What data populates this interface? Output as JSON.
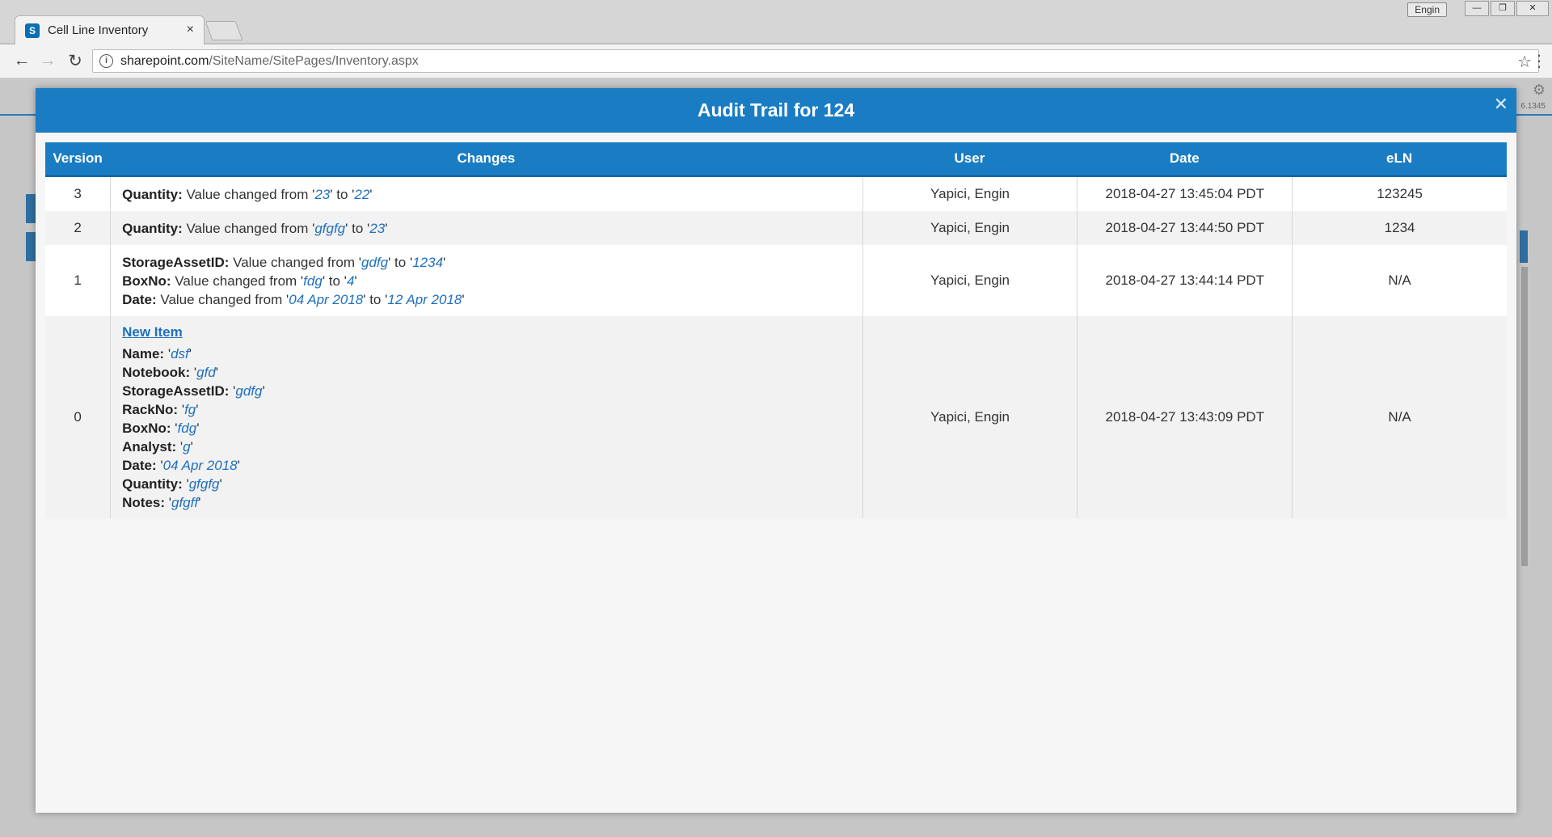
{
  "browser": {
    "user_chip": "Engin",
    "win_minimize": "—",
    "win_maximize": "❐",
    "win_close": "✕",
    "tab_favicon_letter": "S",
    "tab_title": "Cell Line Inventory",
    "tab_close": "×",
    "url_host": "sharepoint.com",
    "url_path": "/SiteName/SitePages/Inventory.aspx",
    "page_number": "6.1345"
  },
  "modal": {
    "title": "Audit Trail for 124",
    "close_glyph": "✕",
    "headers": {
      "version": "Version",
      "changes": "Changes",
      "user": "User",
      "date": "Date",
      "eln": "eLN"
    },
    "rows": [
      {
        "version": "3",
        "user": "Yapici, Engin",
        "date": "2018-04-27 13:45:04 PDT",
        "eln": "123245",
        "changes": [
          {
            "field": "Quantity:",
            "text": " Value changed from '",
            "from": "23",
            "mid": "' to '",
            "to": "22",
            "end": "'"
          }
        ]
      },
      {
        "version": "2",
        "user": "Yapici, Engin",
        "date": "2018-04-27 13:44:50 PDT",
        "eln": "1234",
        "changes": [
          {
            "field": "Quantity:",
            "text": " Value changed from '",
            "from": "gfgfg",
            "mid": "' to '",
            "to": "23",
            "end": "'"
          }
        ]
      },
      {
        "version": "1",
        "user": "Yapici, Engin",
        "date": "2018-04-27 13:44:14 PDT",
        "eln": "N/A",
        "changes": [
          {
            "field": "StorageAssetID:",
            "text": " Value changed from '",
            "from": "gdfg",
            "mid": "' to '",
            "to": "1234",
            "end": "'"
          },
          {
            "field": "BoxNo:",
            "text": " Value changed from '",
            "from": "fdg",
            "mid": "' to '",
            "to": "4",
            "end": "'"
          },
          {
            "field": "Date:",
            "text": " Value changed from '",
            "from": "04 Apr 2018",
            "mid": "' to '",
            "to": "12 Apr 2018",
            "end": "'"
          }
        ]
      },
      {
        "version": "0",
        "user": "Yapici, Engin",
        "date": "2018-04-27 13:43:09 PDT",
        "eln": "N/A",
        "new_item_label": "New Item",
        "fields": [
          {
            "field": "Name:",
            "value": "dsf"
          },
          {
            "field": "Notebook:",
            "value": "gfd"
          },
          {
            "field": "StorageAssetID:",
            "value": "gdfg"
          },
          {
            "field": "RackNo:",
            "value": "fg"
          },
          {
            "field": "BoxNo:",
            "value": "fdg"
          },
          {
            "field": "Analyst:",
            "value": "g"
          },
          {
            "field": "Date:",
            "value": "04 Apr 2018"
          },
          {
            "field": "Quantity:",
            "value": "gfgfg"
          },
          {
            "field": "Notes:",
            "value": "gfgff"
          }
        ]
      }
    ]
  }
}
